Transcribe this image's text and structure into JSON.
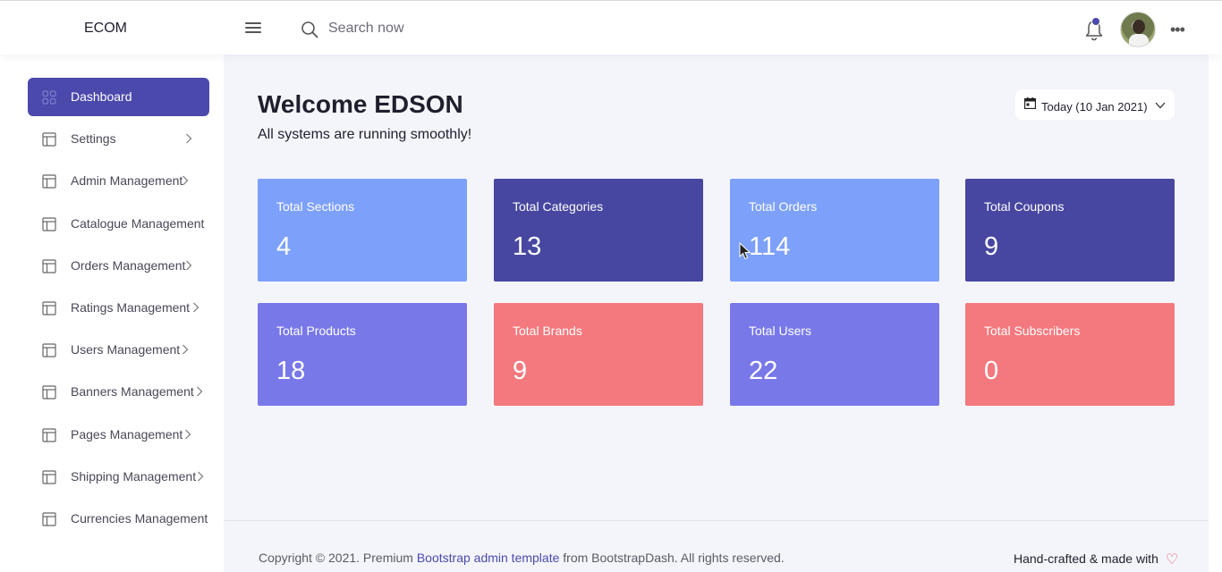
{
  "header": {
    "brand": "ECOM",
    "search_placeholder": "Search now",
    "notification_count_indicator": true
  },
  "sidebar": {
    "items": [
      {
        "label": "Dashboard",
        "active": true
      },
      {
        "label": "Settings",
        "has_submenu": true
      },
      {
        "label": "Admin Management",
        "has_submenu": true
      },
      {
        "label": "Catalogue Management",
        "has_submenu": false
      },
      {
        "label": "Orders Management",
        "has_submenu": true
      },
      {
        "label": "Ratings Management",
        "has_submenu": true
      },
      {
        "label": "Users Management",
        "has_submenu": true
      },
      {
        "label": "Banners Management",
        "has_submenu": true
      },
      {
        "label": "Pages Management",
        "has_submenu": true
      },
      {
        "label": "Shipping Management",
        "has_submenu": true
      },
      {
        "label": "Currencies Management",
        "has_submenu": false
      }
    ]
  },
  "main": {
    "welcome": "Welcome EDSON",
    "subtitle": "All systems are running smoothly!",
    "date_label": "Today (10 Jan 2021)",
    "cards": [
      {
        "title": "Total Sections",
        "value": "4",
        "color": "#7da0fa"
      },
      {
        "title": "Total Categories",
        "value": "13",
        "color": "#4747a1"
      },
      {
        "title": "Total Orders",
        "value": "114",
        "color": "#7da0fa"
      },
      {
        "title": "Total Coupons",
        "value": "9",
        "color": "#4747a1"
      },
      {
        "title": "Total Products",
        "value": "18",
        "color": "#7978e9"
      },
      {
        "title": "Total Brands",
        "value": "9",
        "color": "#f3797e"
      },
      {
        "title": "Total Users",
        "value": "22",
        "color": "#7978e9"
      },
      {
        "title": "Total Subscribers",
        "value": "0",
        "color": "#f3797e"
      }
    ]
  },
  "footer": {
    "copyright_prefix": "Copyright © 2021. Premium ",
    "link_text": "Bootstrap admin template",
    "copyright_suffix": " from BootstrapDash. All rights reserved.",
    "right_text": "Hand-crafted & made with"
  },
  "colors": {
    "accent": "#4b49ac",
    "background": "#f4f5fb",
    "heart": "#e8545f"
  }
}
